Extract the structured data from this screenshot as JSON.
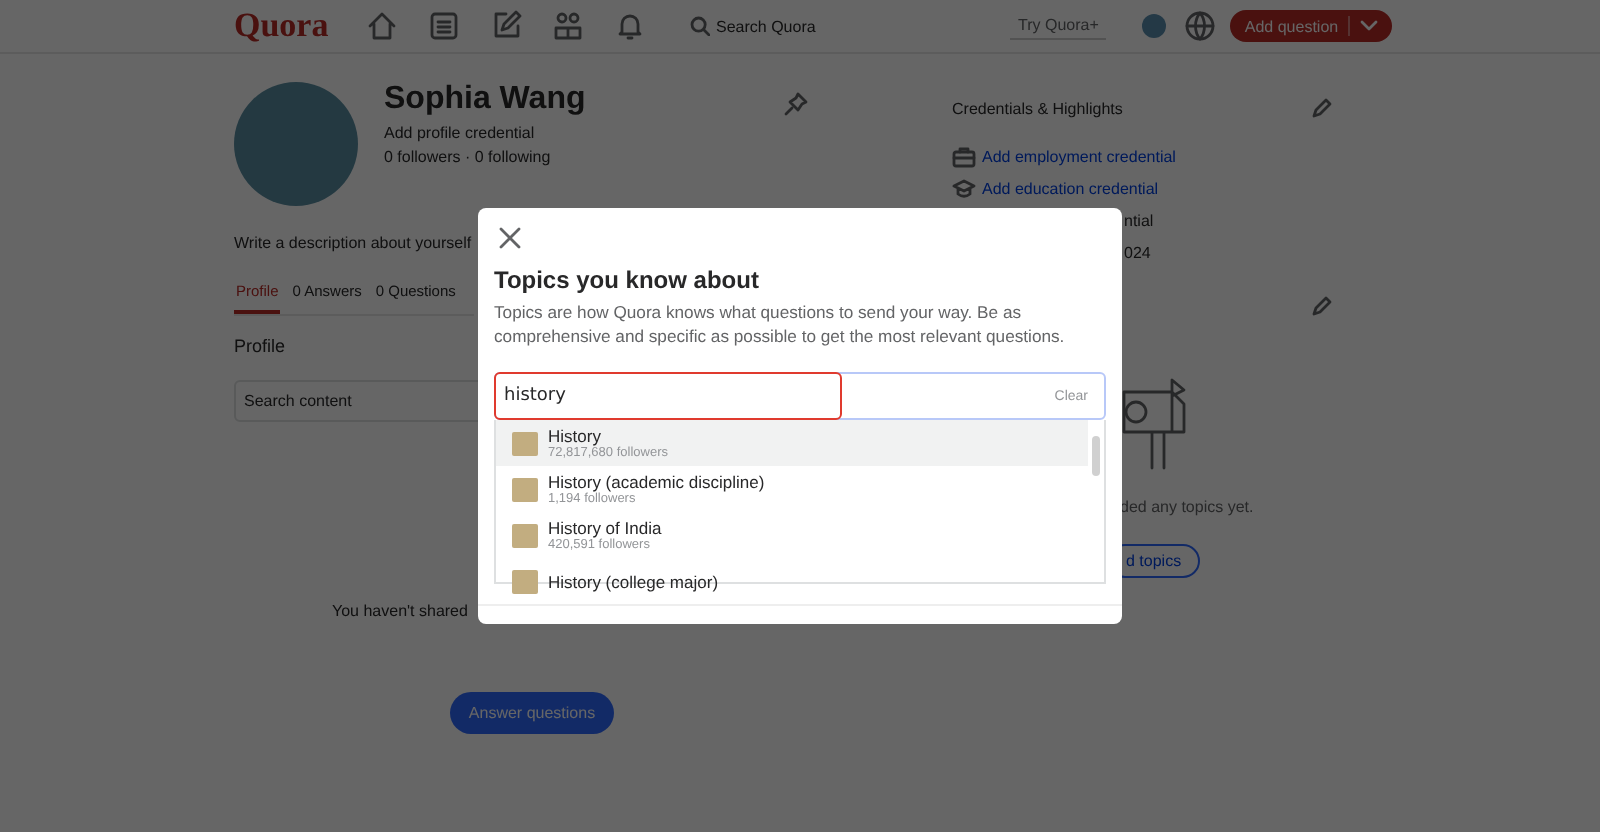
{
  "header": {
    "logo": "Quora",
    "search_placeholder": "Search Quora",
    "try_plus": "Try Quora+",
    "add_question": "Add question"
  },
  "profile": {
    "name": "Sophia Wang",
    "credential": "Add profile credential",
    "follow_stats": "0 followers · 0 following",
    "description_placeholder": "Write a description about yourself"
  },
  "tabs": [
    {
      "label": "Profile",
      "selected": true
    },
    {
      "label": "0 Answers",
      "selected": false
    },
    {
      "label": "0 Questions",
      "selected": false
    }
  ],
  "section_title": "Profile",
  "content_search_placeholder": "Search content",
  "empty_message": "You haven't shared",
  "answer_button": "Answer questions",
  "credentials": {
    "title": "Credentials & Highlights",
    "rows": [
      {
        "kind": "employment",
        "label": "Add employment credential"
      },
      {
        "kind": "education",
        "label": "Add education credential"
      },
      {
        "kind": "plain",
        "label": "ntial"
      },
      {
        "kind": "plain",
        "label": "024"
      }
    ]
  },
  "topics_panel": {
    "empty_text": "ded any topics yet.",
    "button": "d topics"
  },
  "modal": {
    "title": "Topics you know about",
    "description": "Topics are how Quora knows what questions to send your way. Be as comprehensive and specific as possible to get the most relevant questions.",
    "search_value": "history",
    "clear": "Clear",
    "results": [
      {
        "name": "History",
        "followers": "72,817,680 followers",
        "selected": true
      },
      {
        "name": "History (academic discipline)",
        "followers": "1,194 followers",
        "selected": false
      },
      {
        "name": "History of India",
        "followers": "420,591 followers",
        "selected": false
      },
      {
        "name": "History (college major)",
        "selected": false
      }
    ]
  }
}
